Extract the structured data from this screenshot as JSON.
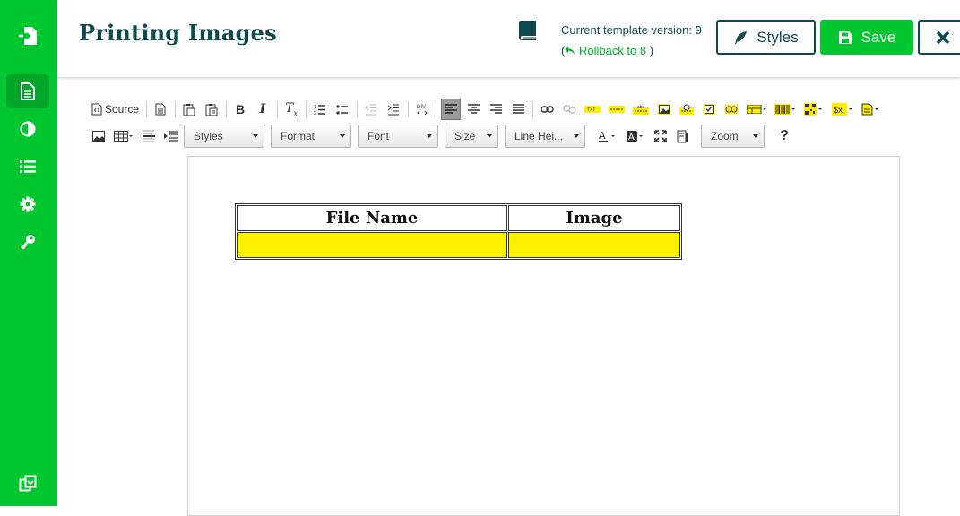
{
  "header": {
    "title": "Printing Images",
    "version_text": "Current template version: 9",
    "rollback_open": "(",
    "rollback_label": "Rollback to 8",
    "rollback_close": ")",
    "styles_label": "Styles",
    "save_label": "Save"
  },
  "sidebar": {
    "items": [
      {
        "icon": "file-export-icon"
      },
      {
        "icon": "document-icon",
        "active": true
      },
      {
        "icon": "contrast-icon"
      },
      {
        "icon": "list-icon"
      },
      {
        "icon": "gear-icon"
      },
      {
        "icon": "key-icon"
      },
      {
        "icon": "copy-icon"
      }
    ]
  },
  "toolbar": {
    "source_label": "Source",
    "styles_combo": "Styles",
    "format_combo": "Format",
    "font_combo": "Font",
    "size_combo": "Size",
    "lineheight_combo": "Line Hei...",
    "zoom_combo": "Zoom",
    "help_label": "?"
  },
  "document": {
    "table": {
      "headers": [
        "File Name",
        "Image"
      ],
      "rows": [
        [
          "",
          ""
        ]
      ]
    }
  },
  "colors": {
    "accent": "#00c72f",
    "dark": "#0d4a4f",
    "highlight": "#fff000"
  }
}
